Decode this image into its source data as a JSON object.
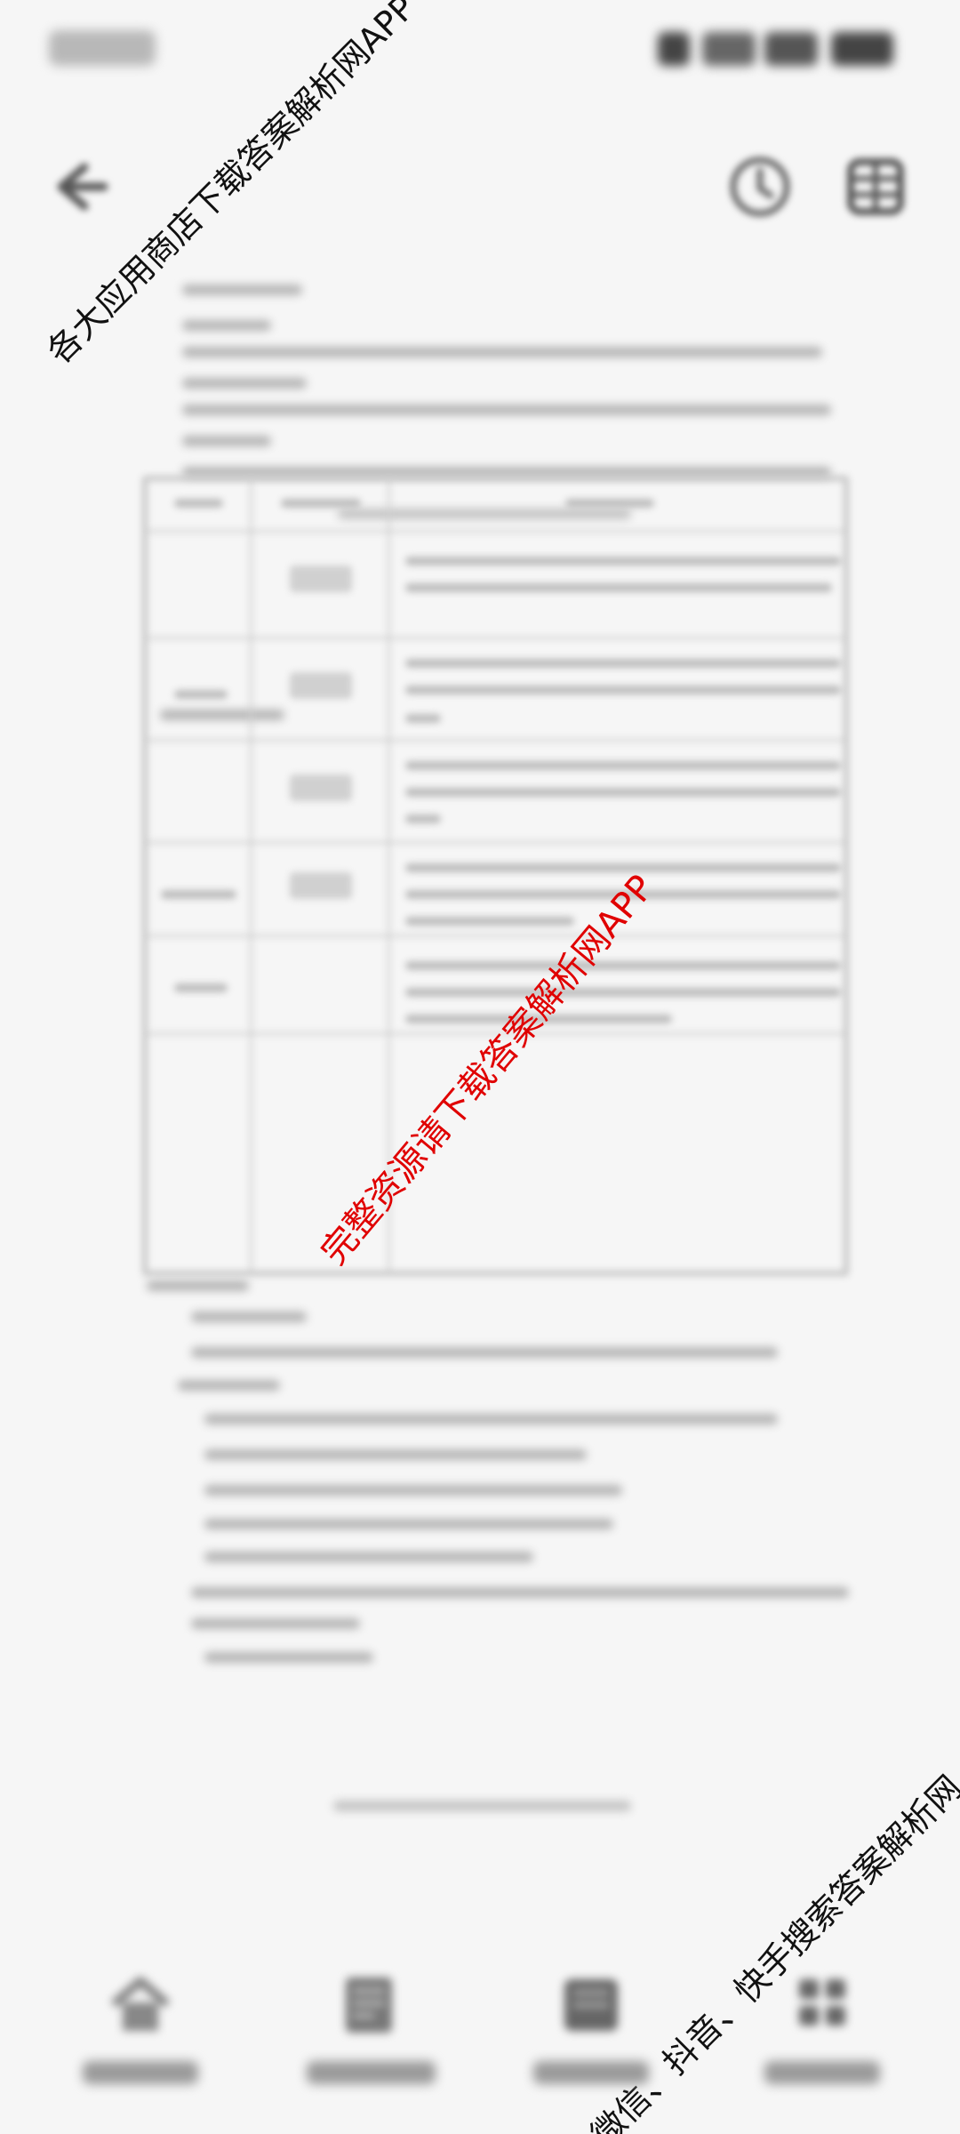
{
  "watermarks": {
    "top_left": "各大应用商店下载答案解析网APP",
    "center": "完整资源请下载答案解析网APP",
    "bottom_right": "微信、抖音、快手搜索答案解析网"
  },
  "colors": {
    "background": "#f6f6f6",
    "watermark_text": "#111111",
    "watermark_accent": "#e00000"
  },
  "toolbar": {
    "back_icon": "back-arrow-icon",
    "history_icon": "clock-icon",
    "menu_icon": "grid-menu-icon"
  },
  "bottom_nav": {
    "items": [
      {
        "icon": "home-icon"
      },
      {
        "icon": "document-icon"
      },
      {
        "icon": "book-icon"
      },
      {
        "icon": "grid-icon"
      }
    ]
  }
}
